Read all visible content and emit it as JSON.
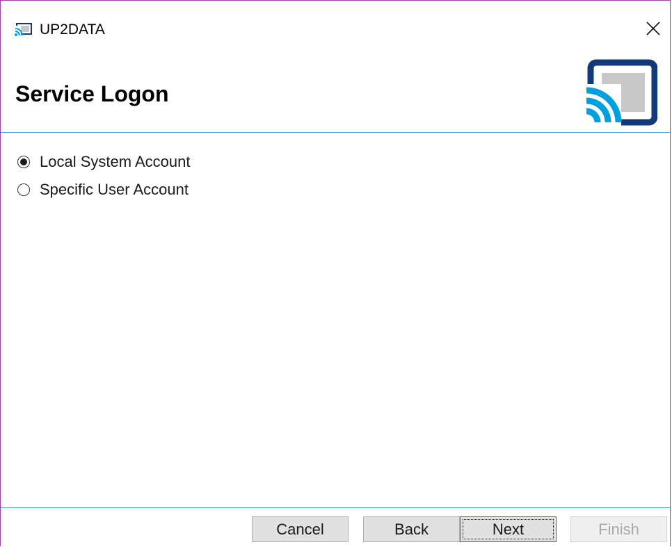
{
  "window": {
    "title": "UP2DATA",
    "app_icon": "cast-wave-icon",
    "close_icon": "close-icon"
  },
  "header": {
    "title": "Service Logon",
    "logo": "up2data-cast-logo"
  },
  "service_logon": {
    "options": [
      {
        "label": "Local System Account",
        "selected": true
      },
      {
        "label": "Specific User Account",
        "selected": false
      }
    ]
  },
  "buttons": {
    "cancel": "Cancel",
    "back": "Back",
    "next": "Next",
    "finish": "Finish"
  },
  "colors": {
    "accent_blue": "#00a0e0",
    "logo_navy": "#123a7a",
    "divider": "#4a9be0",
    "window_border": "#a23ea8"
  }
}
